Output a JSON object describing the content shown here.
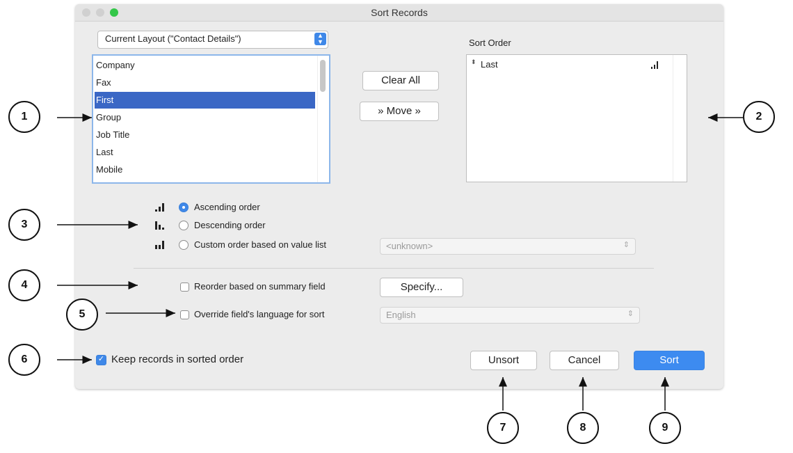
{
  "dialog": {
    "title": "Sort Records",
    "traffic_lights": [
      "#d0d0d0",
      "#d0d0d0",
      "#34c749"
    ]
  },
  "layout_select": {
    "value": "Current Layout (\"Contact Details\")"
  },
  "field_list": {
    "items": [
      "Company",
      "Fax",
      "First",
      "Group",
      "Job Title",
      "Last",
      "Mobile"
    ],
    "selected": "First"
  },
  "buttons": {
    "clear_all": "Clear All",
    "move": "» Move »",
    "specify": "Specify...",
    "unsort": "Unsort",
    "cancel": "Cancel",
    "sort": "Sort"
  },
  "sort_order": {
    "label": "Sort Order",
    "items": [
      {
        "name": "Last",
        "direction_icon": "ascending-icon"
      }
    ]
  },
  "order_options": {
    "ascending": "Ascending order",
    "descending": "Descending order",
    "custom": "Custom order based on value list",
    "selected": "ascending",
    "value_list_placeholder": "<unknown>"
  },
  "summary": {
    "reorder_label": "Reorder based on summary field",
    "checked": false
  },
  "language": {
    "override_label": "Override field's language for sort",
    "checked": false,
    "value": "English"
  },
  "keep_sorted": {
    "label": "Keep records in sorted order",
    "checked": true
  },
  "callouts": [
    "1",
    "2",
    "3",
    "4",
    "5",
    "6",
    "7",
    "8",
    "9"
  ],
  "colors": {
    "accent": "#3f88e8",
    "selection": "#3a67c5"
  }
}
